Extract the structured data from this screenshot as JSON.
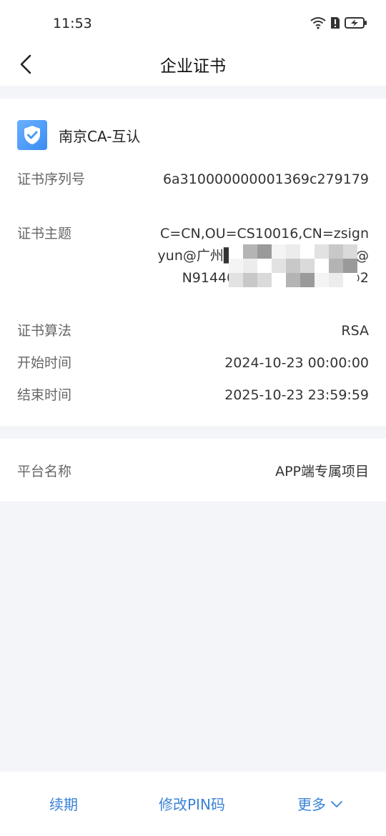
{
  "status_bar": {
    "time": "11:53"
  },
  "nav": {
    "title": "企业证书"
  },
  "certificate": {
    "name": "南京CA-互认",
    "fields": [
      {
        "label": "证书序列号",
        "value": "6a310000000001369c279179"
      },
      {
        "label": "证书主题",
        "value": "C=CN,OU=CS10016,CN=zsignyun@广州██████████公司@N914401█████████5@2"
      },
      {
        "label": "证书算法",
        "value": "RSA"
      },
      {
        "label": "开始时间",
        "value": "2024-10-23 00:00:00"
      },
      {
        "label": "结束时间",
        "value": "2025-10-23 23:59:59"
      }
    ]
  },
  "platform": {
    "label": "平台名称",
    "value": "APP端专属项目"
  },
  "bottom_bar": {
    "renew_label": "续期",
    "change_pin_label": "修改PIN码",
    "more_label": "更多"
  },
  "colors": {
    "accent": "#3a82d8",
    "background": "#f4f5f9",
    "shield": "#4a9af5"
  }
}
